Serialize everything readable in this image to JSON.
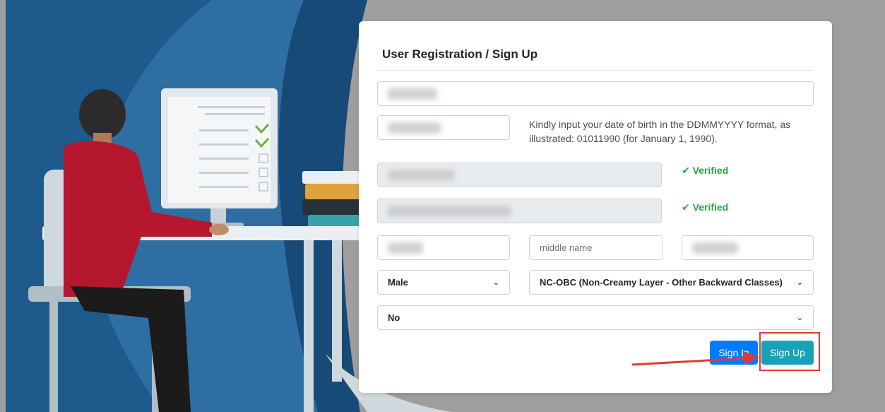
{
  "form": {
    "title": "User Registration / Sign Up",
    "dob_helper": "Kindly input your date of birth in the DDMMYYYY format, as illustrated: 01011990 (for January 1, 1990).",
    "verified_label_1": "Verified",
    "verified_label_2": "Verified",
    "middle_name_placeholder": "middle name",
    "gender_value": "Male",
    "category_value": "NC-OBC (Non-Creamy Layer - Other Backward Classes)",
    "disability_value": "No",
    "signin_label": "Sign In",
    "signup_label": "Sign Up"
  },
  "icons": {
    "verified": "check-icon",
    "dropdown": "chevron-down-icon",
    "annotation": "red-arrow"
  },
  "colors": {
    "primary": "#007bff",
    "info": "#17a2b8",
    "success": "#28a745",
    "annotation": "#e53935"
  }
}
